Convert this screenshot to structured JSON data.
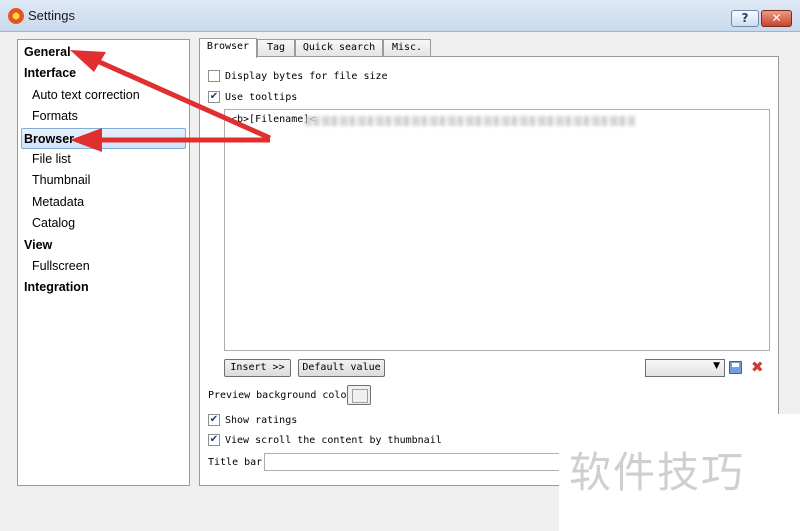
{
  "window": {
    "title": "Settings",
    "help_label": "?",
    "close_label": "✕"
  },
  "nav": {
    "items": [
      {
        "label": "General",
        "type": "category"
      },
      {
        "label": "Interface",
        "type": "category"
      },
      {
        "label": "Auto text correction",
        "type": "sub"
      },
      {
        "label": "Formats",
        "type": "sub"
      },
      {
        "label": "Browser",
        "type": "category",
        "selected": true
      },
      {
        "label": "File list",
        "type": "sub"
      },
      {
        "label": "Thumbnail",
        "type": "sub"
      },
      {
        "label": "Metadata",
        "type": "sub"
      },
      {
        "label": "Catalog",
        "type": "sub"
      },
      {
        "label": "View",
        "type": "category"
      },
      {
        "label": "Fullscreen",
        "type": "sub"
      },
      {
        "label": "Integration",
        "type": "category"
      }
    ]
  },
  "tabs": [
    {
      "label": "Browser",
      "active": true
    },
    {
      "label": "Tag"
    },
    {
      "label": "Quick search"
    },
    {
      "label": "Misc."
    }
  ],
  "browser": {
    "display_bytes": {
      "label": "Display bytes for file size",
      "checked": false
    },
    "use_tooltips": {
      "label": "Use tooltips",
      "checked": true
    },
    "tooltip_template": "<b>[Filename]<",
    "insert_button": "Insert >>",
    "default_value_button": "Default value",
    "preview_bg_label": "Preview background color",
    "show_ratings": {
      "label": "Show ratings",
      "checked": true
    },
    "view_scroll": {
      "label": "View scroll the content by thumbnail",
      "checked": true
    },
    "title_bar_label": "Title bar"
  },
  "watermark": "软件技巧",
  "colors": {
    "arrow": "#e02f2f",
    "selection_border": "#84acdd",
    "delete": "#d03a2c"
  },
  "icons": {
    "app": "sun-icon",
    "save": "save-icon",
    "delete": "delete-icon"
  }
}
